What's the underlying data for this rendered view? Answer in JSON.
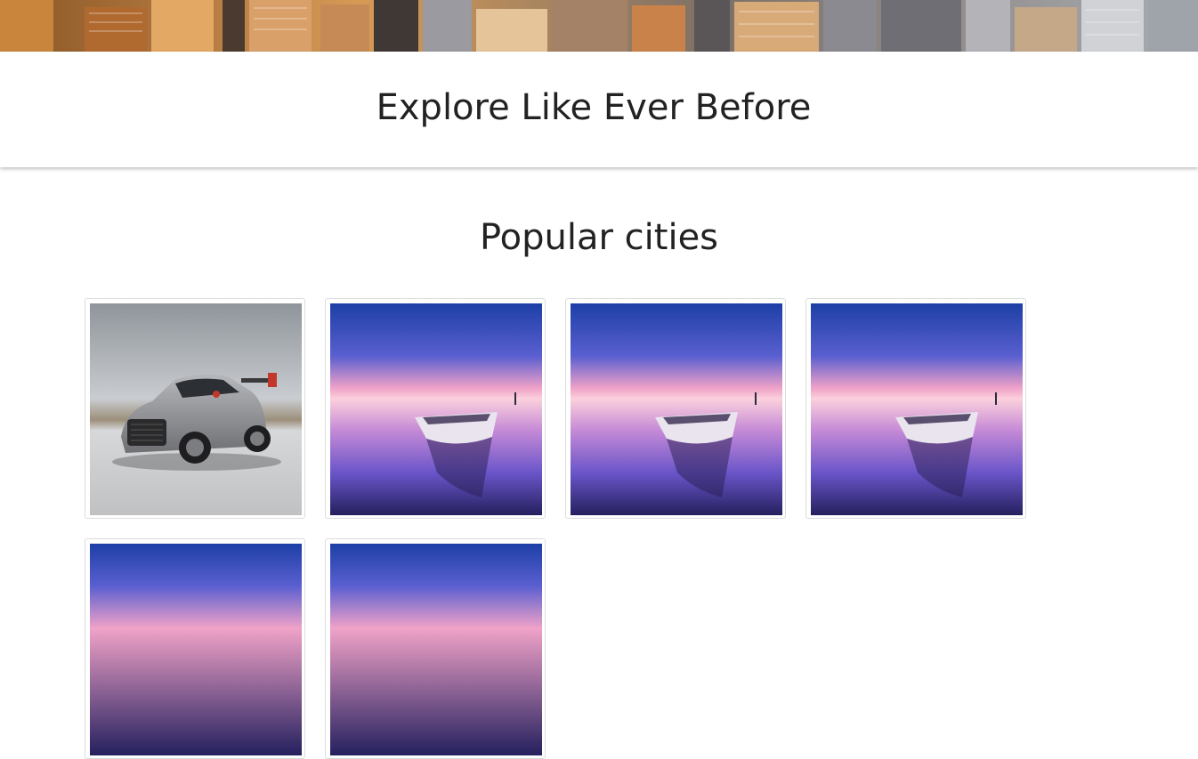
{
  "header": {
    "title": "Explore Like Ever Before"
  },
  "section": {
    "title": "Popular cities"
  },
  "cards": [
    {
      "image": "sports-car-photo"
    },
    {
      "image": "sunset-boat-photo"
    },
    {
      "image": "sunset-boat-photo"
    },
    {
      "image": "sunset-boat-photo"
    },
    {
      "image": "sunset-boat-photo"
    },
    {
      "image": "sunset-boat-photo"
    }
  ],
  "colors": {
    "text": "#222222",
    "card_border": "#dddddd"
  }
}
